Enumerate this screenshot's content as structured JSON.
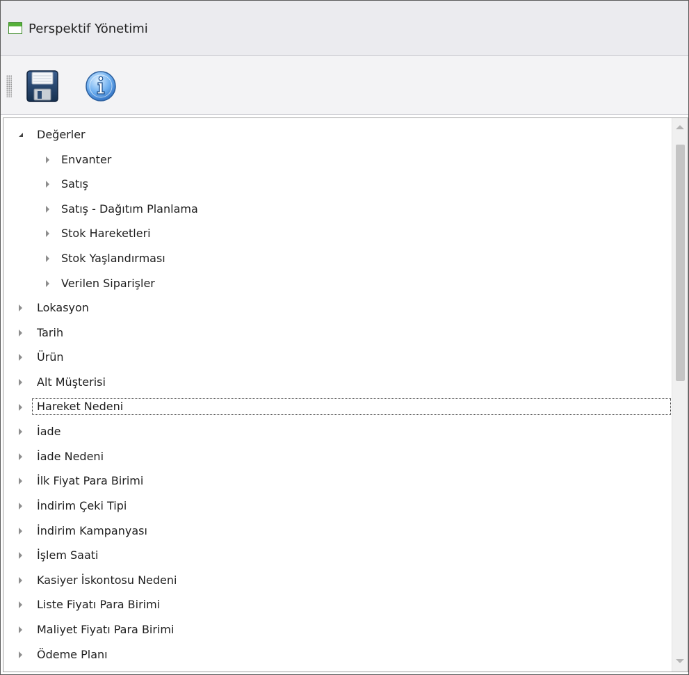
{
  "window": {
    "title": "Perspektif Yönetimi"
  },
  "toolbar": {
    "save_icon": "save-icon",
    "info_icon": "info-icon"
  },
  "tree": {
    "nodes": [
      {
        "label": "Değerler",
        "level": 0,
        "state": "expanded"
      },
      {
        "label": "Envanter",
        "level": 1,
        "state": "collapsed"
      },
      {
        "label": "Satış",
        "level": 1,
        "state": "collapsed"
      },
      {
        "label": "Satış - Dağıtım Planlama",
        "level": 1,
        "state": "collapsed"
      },
      {
        "label": "Stok Hareketleri",
        "level": 1,
        "state": "collapsed"
      },
      {
        "label": "Stok Yaşlandırması",
        "level": 1,
        "state": "collapsed"
      },
      {
        "label": "Verilen Siparişler",
        "level": 1,
        "state": "collapsed"
      },
      {
        "label": "Lokasyon",
        "level": 0,
        "state": "collapsed"
      },
      {
        "label": "Tarih",
        "level": 0,
        "state": "collapsed"
      },
      {
        "label": "Ürün",
        "level": 0,
        "state": "collapsed"
      },
      {
        "label": "Alt Müşterisi",
        "level": 0,
        "state": "collapsed"
      },
      {
        "label": "Hareket Nedeni",
        "level": 0,
        "state": "collapsed",
        "focused": true
      },
      {
        "label": "İade",
        "level": 0,
        "state": "collapsed"
      },
      {
        "label": "İade Nedeni",
        "level": 0,
        "state": "collapsed"
      },
      {
        "label": "İlk Fiyat Para Birimi",
        "level": 0,
        "state": "collapsed"
      },
      {
        "label": "İndirim Çeki Tipi",
        "level": 0,
        "state": "collapsed"
      },
      {
        "label": "İndirim Kampanyası",
        "level": 0,
        "state": "collapsed"
      },
      {
        "label": "İşlem Saati",
        "level": 0,
        "state": "collapsed"
      },
      {
        "label": "Kasiyer İskontosu Nedeni",
        "level": 0,
        "state": "collapsed"
      },
      {
        "label": "Liste Fiyatı Para Birimi",
        "level": 0,
        "state": "collapsed"
      },
      {
        "label": "Maliyet Fiyatı Para Birimi",
        "level": 0,
        "state": "collapsed"
      },
      {
        "label": "Ödeme Planı",
        "level": 0,
        "state": "collapsed"
      }
    ]
  },
  "colors": {
    "titlebar_bg": "#ebebef",
    "toolbar_bg": "#f3f3f5",
    "accent_green": "#56b13a",
    "save_blue": "#1f3f6b",
    "info_blue": "#3d7fd0"
  }
}
